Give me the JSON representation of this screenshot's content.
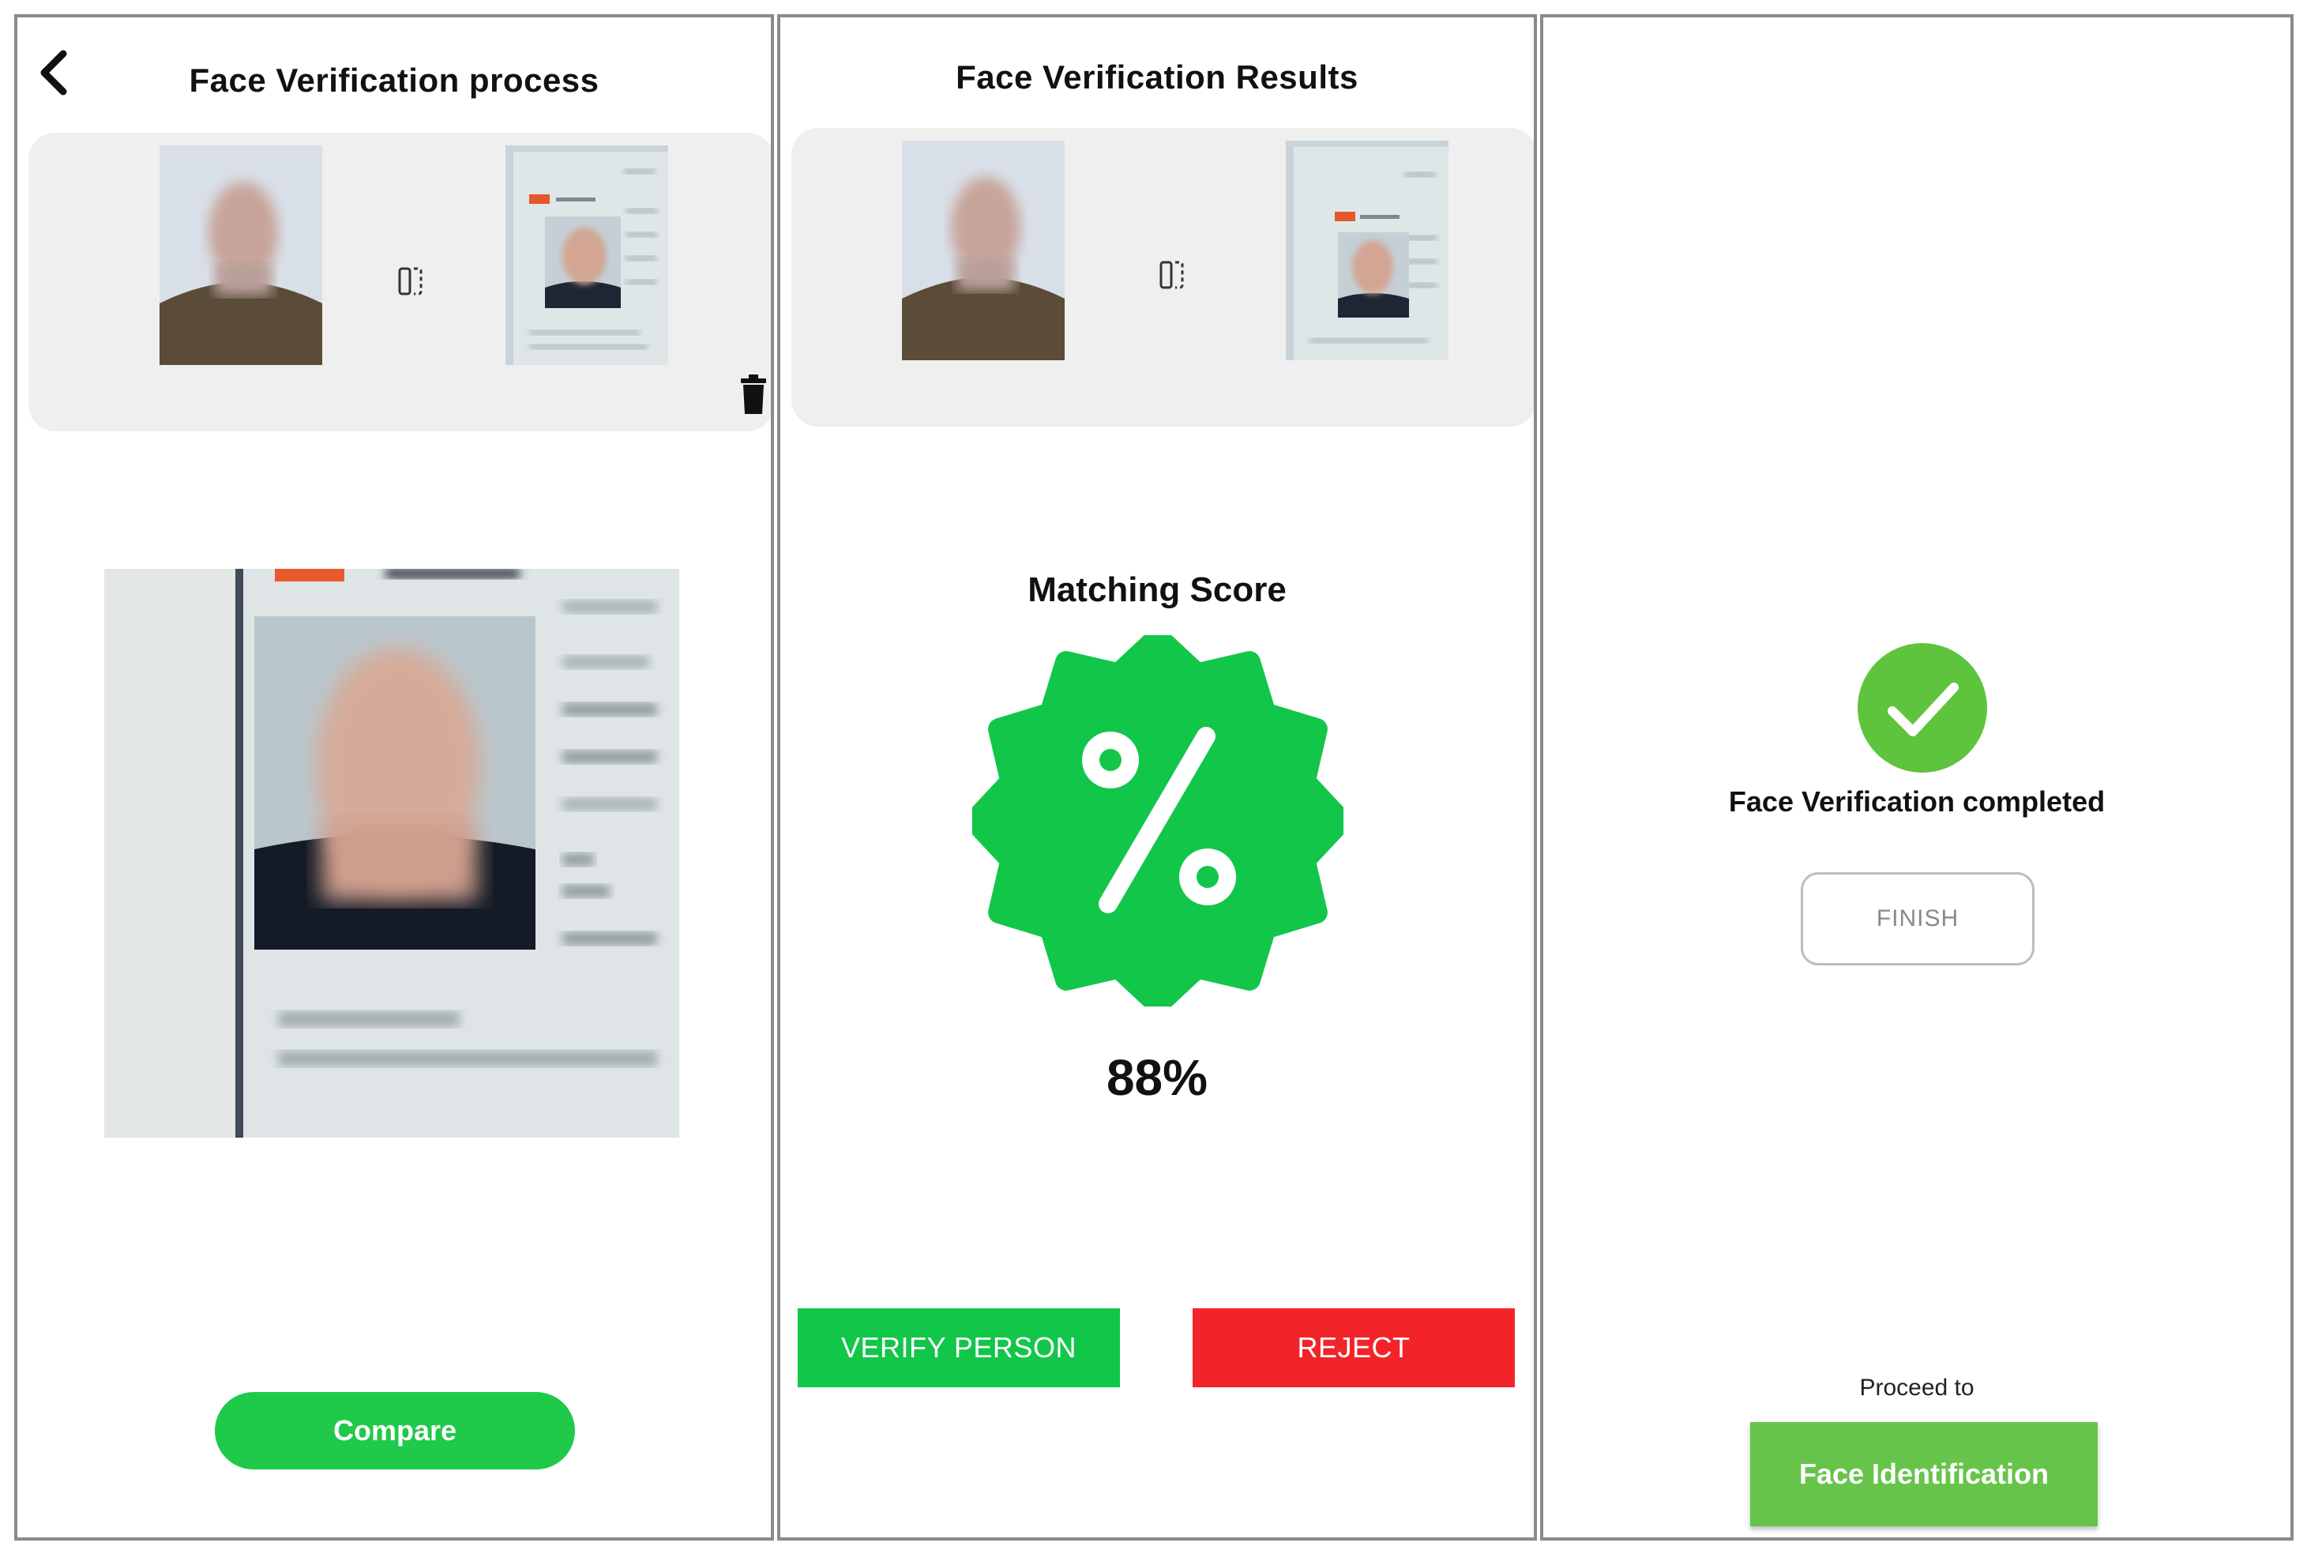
{
  "process": {
    "title": "Face Verification process",
    "compare_label": "Compare",
    "back_icon": "chevron-left-icon",
    "delete_icon": "trash-icon",
    "swap_icon": "swap-icon"
  },
  "results": {
    "title": "Face Verification Results",
    "matching_score_label": "Matching Score",
    "matching_score": "88%",
    "verify_label": "VERIFY PERSON",
    "reject_label": "REJECT",
    "badge_icon": "percent-badge-icon"
  },
  "completed": {
    "message": "Face Verification completed",
    "finish_label": "FINISH",
    "proceed_to": "Proceed to",
    "face_identification_label": "Face Identification",
    "check_icon": "check-circle-icon"
  },
  "colors": {
    "green": "#1fc94a",
    "red": "#f2242a",
    "light_green": "#67c44a",
    "panel_bg": "#efefef"
  }
}
